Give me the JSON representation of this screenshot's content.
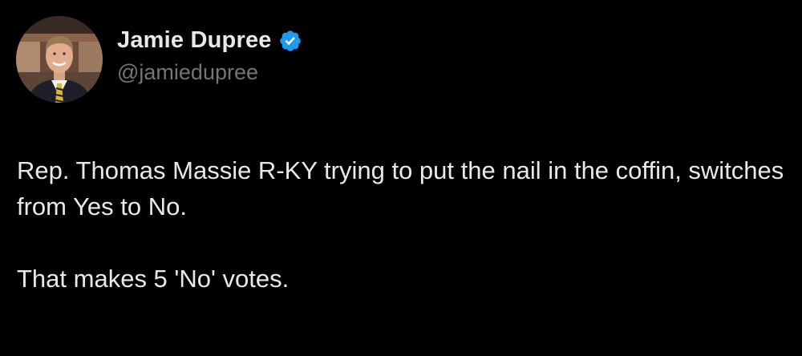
{
  "author": {
    "display_name": "Jamie Dupree",
    "handle": "@jamiedupree",
    "verified": true,
    "verified_color": "#1d9bf0"
  },
  "tweet": {
    "paragraphs": [
      "Rep. Thomas Massie R-KY trying to put the nail in the coffin, switches from Yes to No.",
      "That makes 5 'No' votes."
    ]
  },
  "icons": {
    "verified": "verified-badge-icon",
    "avatar": "profile-photo"
  },
  "colors": {
    "background": "#000000",
    "text": "#e7e9ea",
    "secondary_text": "#71767b"
  }
}
